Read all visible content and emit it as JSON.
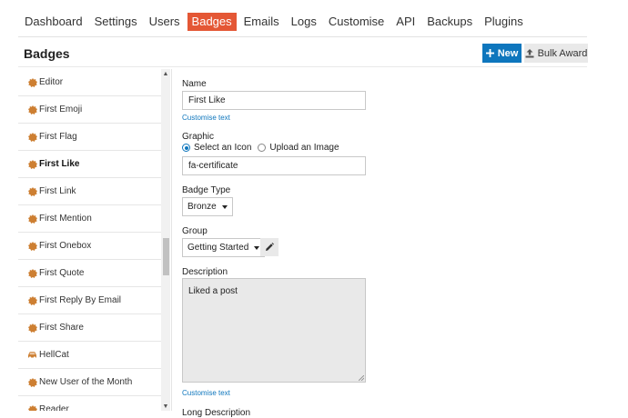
{
  "nav": {
    "tabs": [
      {
        "label": "Dashboard"
      },
      {
        "label": "Settings"
      },
      {
        "label": "Users"
      },
      {
        "label": "Badges",
        "active": true
      },
      {
        "label": "Emails"
      },
      {
        "label": "Logs"
      },
      {
        "label": "Customise"
      },
      {
        "label": "API"
      },
      {
        "label": "Backups"
      },
      {
        "label": "Plugins"
      }
    ]
  },
  "header": {
    "title": "Badges",
    "new_label": "New",
    "bulk_award_label": "Bulk Award"
  },
  "badge_list": {
    "items": [
      {
        "label": "Editor",
        "icon": "certificate-icon"
      },
      {
        "label": "First Emoji",
        "icon": "certificate-icon"
      },
      {
        "label": "First Flag",
        "icon": "certificate-icon"
      },
      {
        "label": "First Like",
        "icon": "certificate-icon",
        "active": true
      },
      {
        "label": "First Link",
        "icon": "certificate-icon"
      },
      {
        "label": "First Mention",
        "icon": "certificate-icon"
      },
      {
        "label": "First Onebox",
        "icon": "certificate-icon"
      },
      {
        "label": "First Quote",
        "icon": "certificate-icon"
      },
      {
        "label": "First Reply By Email",
        "icon": "certificate-icon"
      },
      {
        "label": "First Share",
        "icon": "certificate-icon"
      },
      {
        "label": "HellCat",
        "icon": "car-icon"
      },
      {
        "label": "New User of the Month",
        "icon": "certificate-icon"
      },
      {
        "label": "Reader",
        "icon": "certificate-icon"
      }
    ]
  },
  "form": {
    "name_label": "Name",
    "name_value": "First Like",
    "customise_text_link": "Customise text",
    "graphic_label": "Graphic",
    "graphic_option_icon": "Select an Icon",
    "graphic_option_image": "Upload an Image",
    "graphic_value": "fa-certificate",
    "badge_type_label": "Badge Type",
    "badge_type_value": "Bronze",
    "group_label": "Group",
    "group_value": "Getting Started",
    "description_label": "Description",
    "description_value": "Liked a post",
    "description_customise_link": "Customise text",
    "long_description_label": "Long Description"
  },
  "colors": {
    "accent": "#e45735",
    "primary": "#0e76bd",
    "bronze": "#cd7f32"
  }
}
